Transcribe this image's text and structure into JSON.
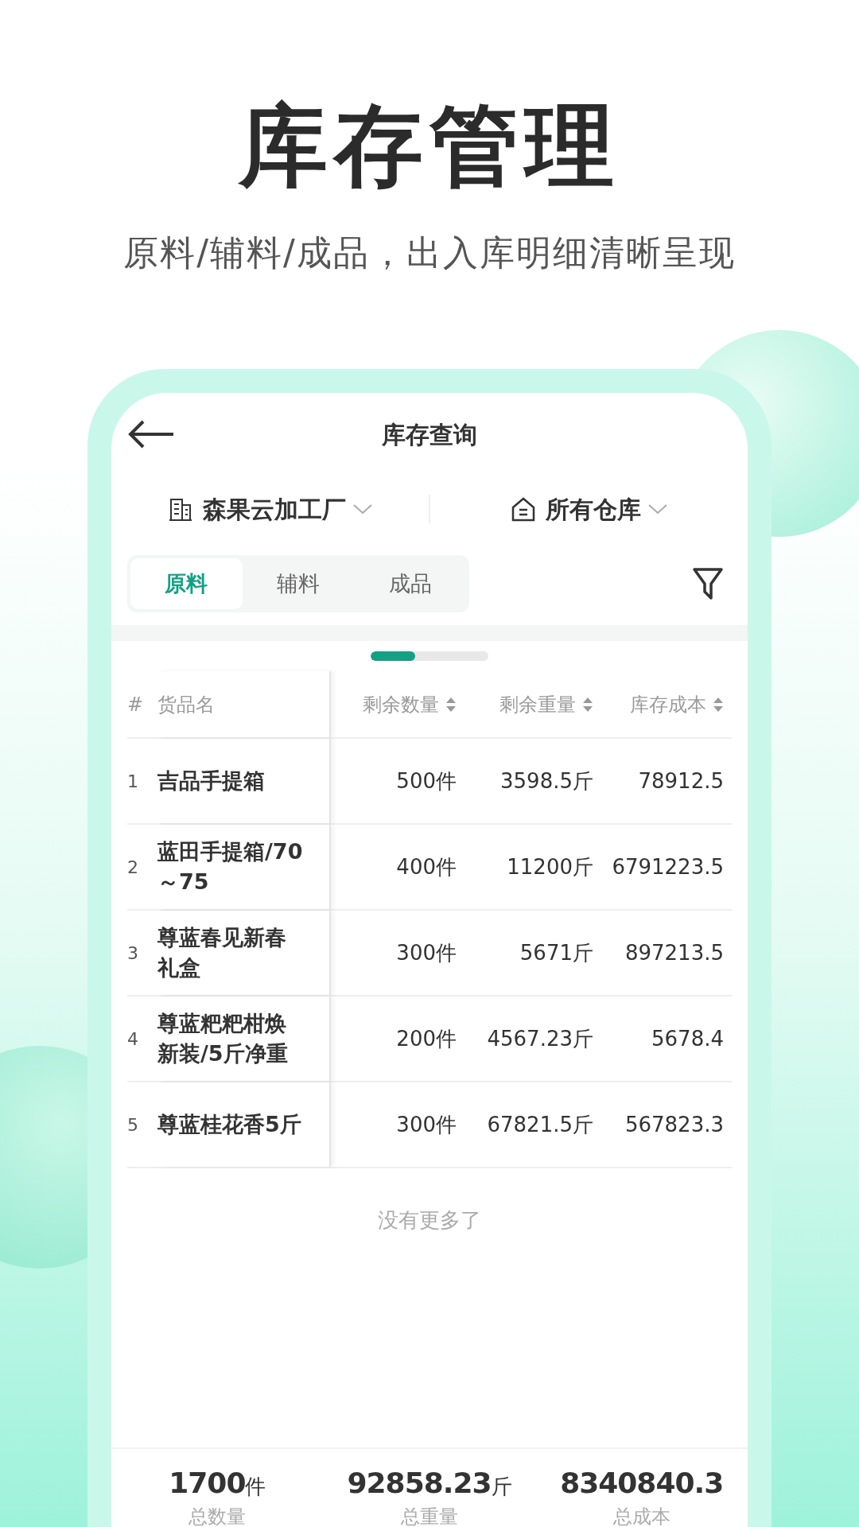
{
  "headline": "库存管理",
  "subtitle": "原料/辅料/成品，出入库明细清晰呈现",
  "screen": {
    "title": "库存查询",
    "factory": "森果云加工厂",
    "warehouse": "所有仓库",
    "tabs": [
      {
        "label": "原料",
        "selected": true
      },
      {
        "label": "辅料",
        "selected": false
      },
      {
        "label": "成品",
        "selected": false
      }
    ],
    "table": {
      "columns": [
        "#",
        "货品名",
        "剩余数量",
        "剩余重量",
        "库存成本"
      ],
      "rows": [
        {
          "index": "1",
          "name": "吉品手提箱",
          "qty": "500件",
          "weight": "3598.5斤",
          "cost": "78912.5"
        },
        {
          "index": "2",
          "name": "蓝田手提箱/70～75",
          "qty": "400件",
          "weight": "11200斤",
          "cost": "6791223.5"
        },
        {
          "index": "3",
          "name": "尊蓝春见新春礼盒",
          "qty": "300件",
          "weight": "5671斤",
          "cost": "897213.5"
        },
        {
          "index": "4",
          "name": "尊蓝粑粑柑焕新装/5斤净重",
          "qty": "200件",
          "weight": "4567.23斤",
          "cost": "5678.4"
        },
        {
          "index": "5",
          "name": "尊蓝桂花香5斤",
          "qty": "300件",
          "weight": "67821.5斤",
          "cost": "567823.3"
        }
      ]
    },
    "end_note": "没有更多了",
    "totals": [
      {
        "value": "1700",
        "unit": "件",
        "label": "总数量"
      },
      {
        "value": "92858.23",
        "unit": "斤",
        "label": "总重量"
      },
      {
        "value": "8340840.3",
        "label": "总成本"
      }
    ]
  }
}
